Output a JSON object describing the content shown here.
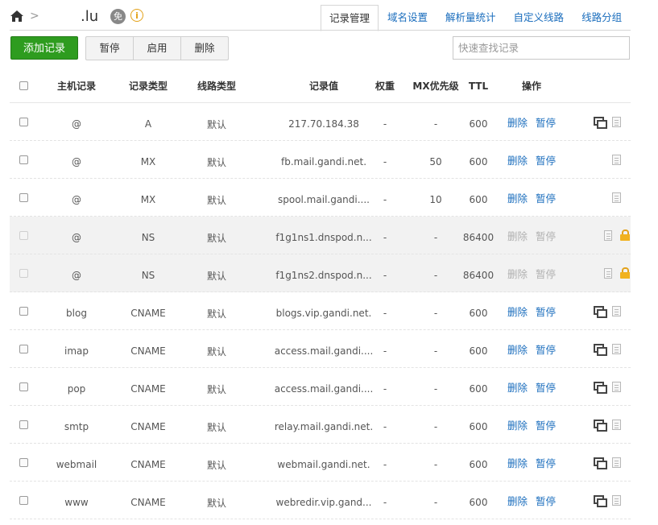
{
  "breadcrumb": {
    "separator": ">",
    "domain": ".lu",
    "free_badge": "免",
    "info": "i"
  },
  "tabs": [
    {
      "label": "记录管理",
      "active": true
    },
    {
      "label": "域名设置"
    },
    {
      "label": "解析量统计"
    },
    {
      "label": "自定义线路"
    },
    {
      "label": "线路分组"
    }
  ],
  "toolbar": {
    "add_label": "添加记录",
    "pause_label": "暂停",
    "enable_label": "启用",
    "delete_label": "删除",
    "search_placeholder": "快速查找记录"
  },
  "table": {
    "headers": {
      "host": "主机记录",
      "type": "记录类型",
      "line": "线路类型",
      "value": "记录值",
      "weight": "权重",
      "mx": "MX优先级",
      "ttl": "TTL",
      "ops": "操作"
    },
    "op_delete": "删除",
    "op_pause": "暂停",
    "rows": [
      {
        "host": "@",
        "type": "A",
        "line": "默认",
        "value": "217.70.184.38",
        "weight": "-",
        "mx": "-",
        "ttl": "600",
        "locked": false,
        "copy": true
      },
      {
        "host": "@",
        "type": "MX",
        "line": "默认",
        "value": "fb.mail.gandi.net.",
        "weight": "-",
        "mx": "50",
        "ttl": "600",
        "locked": false,
        "copy": false
      },
      {
        "host": "@",
        "type": "MX",
        "line": "默认",
        "value": "spool.mail.gandi....",
        "weight": "-",
        "mx": "10",
        "ttl": "600",
        "locked": false,
        "copy": false
      },
      {
        "host": "@",
        "type": "NS",
        "line": "默认",
        "value": "f1g1ns1.dnspod.n...",
        "weight": "-",
        "mx": "-",
        "ttl": "86400",
        "locked": true,
        "copy": false
      },
      {
        "host": "@",
        "type": "NS",
        "line": "默认",
        "value": "f1g1ns2.dnspod.n...",
        "weight": "-",
        "mx": "-",
        "ttl": "86400",
        "locked": true,
        "copy": false
      },
      {
        "host": "blog",
        "type": "CNAME",
        "line": "默认",
        "value": "blogs.vip.gandi.net.",
        "weight": "-",
        "mx": "-",
        "ttl": "600",
        "locked": false,
        "copy": true
      },
      {
        "host": "imap",
        "type": "CNAME",
        "line": "默认",
        "value": "access.mail.gandi....",
        "weight": "-",
        "mx": "-",
        "ttl": "600",
        "locked": false,
        "copy": true
      },
      {
        "host": "pop",
        "type": "CNAME",
        "line": "默认",
        "value": "access.mail.gandi....",
        "weight": "-",
        "mx": "-",
        "ttl": "600",
        "locked": false,
        "copy": true
      },
      {
        "host": "smtp",
        "type": "CNAME",
        "line": "默认",
        "value": "relay.mail.gandi.net.",
        "weight": "-",
        "mx": "-",
        "ttl": "600",
        "locked": false,
        "copy": true
      },
      {
        "host": "webmail",
        "type": "CNAME",
        "line": "默认",
        "value": "webmail.gandi.net.",
        "weight": "-",
        "mx": "-",
        "ttl": "600",
        "locked": false,
        "copy": true
      },
      {
        "host": "www",
        "type": "CNAME",
        "line": "默认",
        "value": "webredir.vip.gand...",
        "weight": "-",
        "mx": "-",
        "ttl": "600",
        "locked": false,
        "copy": true
      }
    ]
  }
}
